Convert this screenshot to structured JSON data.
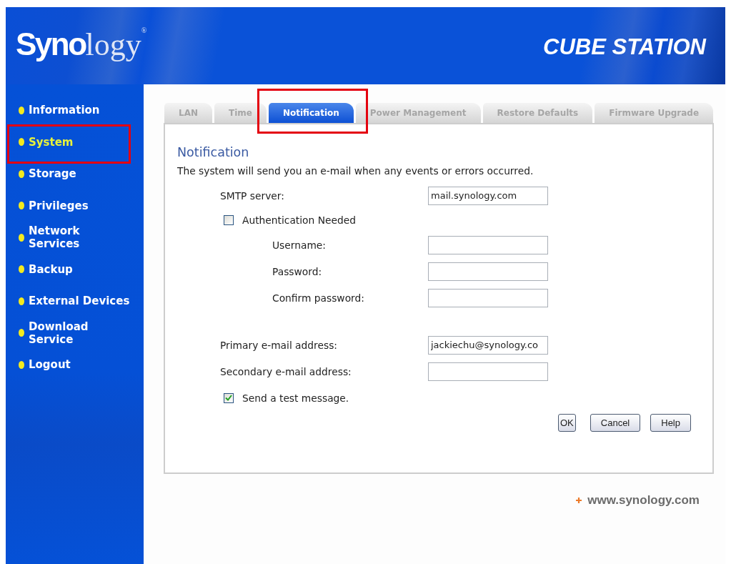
{
  "header": {
    "logo": "**Syno**logy$^{®}$",
    "product_name": "CUBE STATION"
  },
  "sidebar": {
    "items": [
      {
        "label": "Information",
        "selected": false,
        "highlighted": false
      },
      {
        "label": "System",
        "selected": true,
        "highlighted": true
      },
      {
        "label": "Storage",
        "selected": false,
        "highlighted": false
      },
      {
        "label": "Privileges",
        "selected": false,
        "highlighted": false
      },
      {
        "label": "Network\nServices",
        "selected": false,
        "highlighted": false
      },
      {
        "label": "Backup",
        "selected": false,
        "highlighted": false
      },
      {
        "label": "External Devices",
        "selected": false,
        "highlighted": false
      },
      {
        "label": "Download\nService",
        "selected": false,
        "highlighted": false
      },
      {
        "label": "Logout",
        "selected": false,
        "highlighted": false
      }
    ]
  },
  "tabs": [
    {
      "label": "LAN",
      "selected": false,
      "highlighted": false
    },
    {
      "label": "Time",
      "selected": false,
      "highlighted": false
    },
    {
      "label": "Notification",
      "selected": true,
      "highlighted": true
    },
    {
      "label": "Power Management",
      "selected": false,
      "highlighted": false
    },
    {
      "label": "Restore Defaults",
      "selected": false,
      "highlighted": false
    },
    {
      "label": "Firmware Upgrade",
      "selected": false,
      "highlighted": false
    }
  ],
  "panel": {
    "title": "Notification",
    "description": "The system will send you an e-mail when any events or errors occurred."
  },
  "form": {
    "rows": [
      {
        "kind": "field",
        "label": "SMTP server:",
        "value": "mail.synology.com"
      },
      {
        "kind": "checkbox",
        "label": "Authentication Needed",
        "checked": false,
        "children": [
          {
            "kind": "field",
            "label": "Username:"
          },
          {
            "kind": "field",
            "label": "Password:"
          },
          {
            "kind": "field",
            "label": "Confirm password:"
          }
        ]
      },
      {
        "kind": "field",
        "label": "Primary e-mail address:",
        "value": "jackiechu@synology.co"
      },
      {
        "kind": "field",
        "label": "Secondary e-mail address:"
      },
      {
        "kind": "checkbox",
        "label": "Send a test message.",
        "checked": true
      }
    ]
  },
  "buttons": [
    "OK",
    "Cancel",
    "Help"
  ],
  "footer": {
    "link": "www.synology.com"
  }
}
